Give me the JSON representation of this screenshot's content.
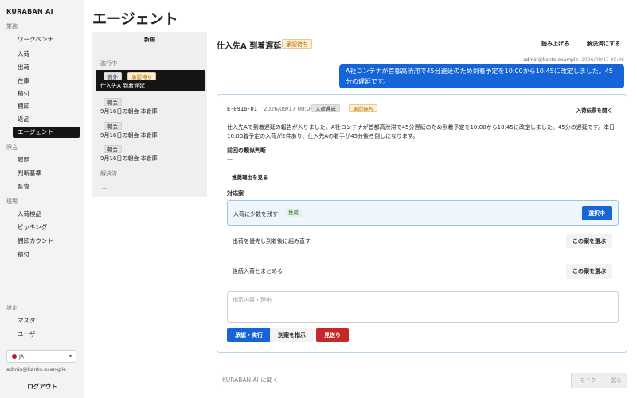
{
  "app": {
    "brand": "KURABAN AI"
  },
  "sidebar": {
    "sections": [
      {
        "label": "業務",
        "items": [
          "ワークベンチ",
          "入荷",
          "出荷",
          "在庫",
          "積付",
          "棚卸",
          "返品",
          "エージェント"
        ]
      },
      {
        "label": "照会",
        "items": [
          "履歴",
          "判断基準",
          "監査"
        ]
      },
      {
        "label": "現場",
        "items": [
          "入荷検品",
          "ピッキング",
          "棚卸カウント",
          "積付"
        ]
      },
      {
        "label": "設定",
        "items": [
          "マスタ",
          "ユーザ"
        ]
      }
    ],
    "active_item": "エージェント",
    "language": "JA",
    "user_email": "admin@kanto.example",
    "logout_label": "ログアウト"
  },
  "page": {
    "title": "エージェント"
  },
  "list_panel": {
    "new_label": "新規",
    "in_progress_label": "進行中",
    "items": [
      {
        "tags": [
          "例外",
          "承認待ち"
        ],
        "title": "仕入先A 到着遅延"
      },
      {
        "tags": [
          "朝会"
        ],
        "title": "9月16日の朝会 本倉庫"
      },
      {
        "tags": [
          "朝会"
        ],
        "title": "9月16日の朝会 本倉庫"
      },
      {
        "tags": [
          "朝会"
        ],
        "title": "9月16日の朝会 本倉庫"
      }
    ],
    "resolved_label": "解決済",
    "resolved_empty": "—"
  },
  "conversation": {
    "title": "仕入先A 到着遅延",
    "status": "承認待ち",
    "read_aloud_label": "読み上げる",
    "mark_resolved_label": "解決済にする",
    "user_message": {
      "author": "admin@kanto.example",
      "timestamp": "2026/09/17 00:06",
      "text": "A社コンテナが首都高渋滞で45分遅延のため到着予定を10:00から10:45に改定しました。45分の遅延です。"
    },
    "card": {
      "id": "E-0916-01",
      "timestamp": "2026/09/17 00:06",
      "tags": [
        "入荷遅延",
        "承認待ち"
      ],
      "open_slip_label": "入荷伝票を開く",
      "body": "仕入先Aで到着遅延の報告が入りました。A社コンテナが首都高渋滞で45分遅延のため到着予定を10:00から10:45に改定しました。45分の遅延です。本日10:00着予定の入荷が2件あり、仕入先Aの着手が45分後ろ倒しになります。",
      "prior_judgment_label": "前回の類似判断",
      "prior_judgment_value": "—",
      "show_reason_label": "推奨理由を見る",
      "options_label": "対応案",
      "options": [
        {
          "label": "入荷に少数を残す",
          "badge": "推奨",
          "button": "選択中",
          "selected": true
        },
        {
          "label": "出荷を優先し到着後に組み直す",
          "badge": "",
          "button": "この案を選ぶ",
          "selected": false
        },
        {
          "label": "後続入荷とまとめる",
          "badge": "",
          "button": "この案を選ぶ",
          "selected": false
        }
      ],
      "reason_placeholder": "指示内容・理由",
      "approve_label": "承認・実行",
      "alternative_label": "別案を指示",
      "reject_label": "見送り"
    }
  },
  "chat": {
    "placeholder": "KURABAN AI に聞く",
    "mic_label": "マイク",
    "send_label": "送る"
  },
  "colors": {
    "accent": "#1565d8",
    "active_nav": "#151515",
    "pending_badge": "#b46a00",
    "recommend_badge": "#2f7d32",
    "reject": "#c62828"
  }
}
